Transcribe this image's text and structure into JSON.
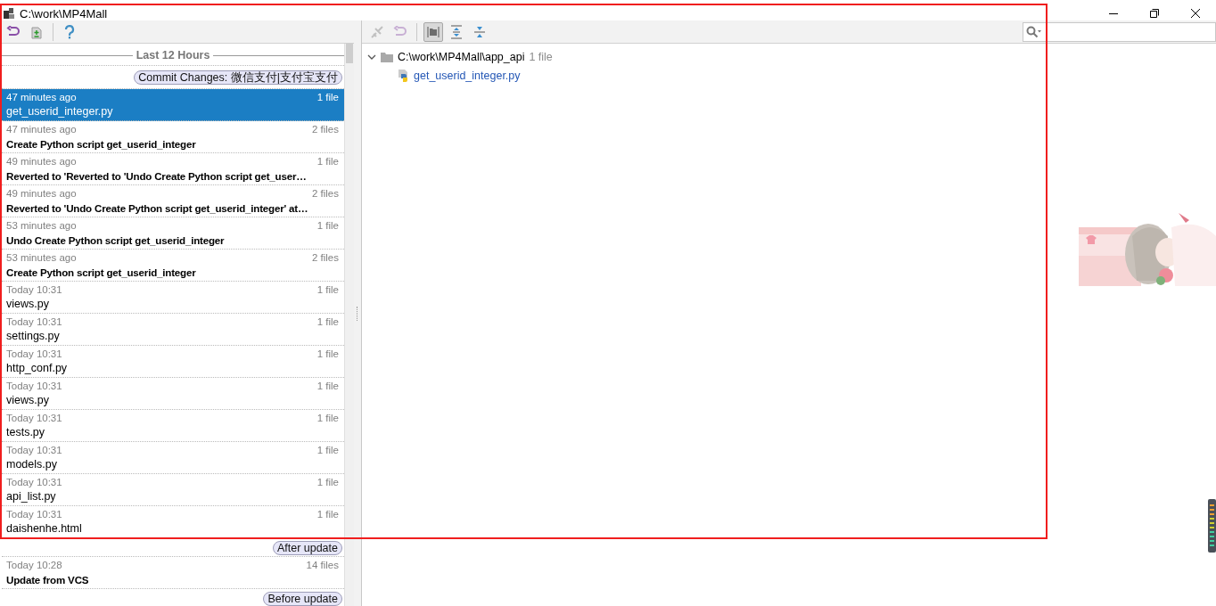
{
  "window": {
    "title": "C:\\work\\MP4Mall"
  },
  "left_toolbar": [
    {
      "kind": "undo",
      "disabled": false
    },
    {
      "kind": "patch",
      "disabled": false
    },
    {
      "kind": "separator"
    },
    {
      "kind": "help",
      "disabled": false
    }
  ],
  "right_toolbar": [
    {
      "kind": "revert",
      "disabled": true,
      "pressed": false
    },
    {
      "kind": "undo",
      "disabled": true,
      "pressed": false
    },
    {
      "kind": "separator"
    },
    {
      "kind": "group",
      "disabled": false,
      "pressed": true
    },
    {
      "kind": "expand",
      "disabled": false,
      "pressed": false
    },
    {
      "kind": "collapse",
      "disabled": false,
      "pressed": false
    }
  ],
  "history": {
    "period": "Last 12 Hours",
    "rows": [
      {
        "kind": "label",
        "text": "Commit Changes: 微信支付|支付宝支付"
      },
      {
        "kind": "entry",
        "time": "47 minutes ago",
        "count": "1 file",
        "title": "get_userid_integer.py",
        "bold": false,
        "selected": true
      },
      {
        "kind": "entry",
        "time": "47 minutes ago",
        "count": "2 files",
        "title": "Create Python script get_userid_integer",
        "bold": true,
        "selected": false
      },
      {
        "kind": "entry",
        "time": "49 minutes ago",
        "count": "1 file",
        "title": "Reverted to 'Reverted to 'Undo Create Python script get_user…",
        "bold": true,
        "selected": false
      },
      {
        "kind": "entry",
        "time": "49 minutes ago",
        "count": "2 files",
        "title": "Reverted to 'Undo Create Python script get_userid_integer' at…",
        "bold": true,
        "selected": false
      },
      {
        "kind": "entry",
        "time": "53 minutes ago",
        "count": "1 file",
        "title": "Undo Create Python script get_userid_integer",
        "bold": true,
        "selected": false
      },
      {
        "kind": "entry",
        "time": "53 minutes ago",
        "count": "2 files",
        "title": "Create Python script get_userid_integer",
        "bold": true,
        "selected": false
      },
      {
        "kind": "entry",
        "time": "Today 10:31",
        "count": "1 file",
        "title": "views.py",
        "bold": false,
        "selected": false
      },
      {
        "kind": "entry",
        "time": "Today 10:31",
        "count": "1 file",
        "title": "settings.py",
        "bold": false,
        "selected": false
      },
      {
        "kind": "entry",
        "time": "Today 10:31",
        "count": "1 file",
        "title": "http_conf.py",
        "bold": false,
        "selected": false
      },
      {
        "kind": "entry",
        "time": "Today 10:31",
        "count": "1 file",
        "title": "views.py",
        "bold": false,
        "selected": false
      },
      {
        "kind": "entry",
        "time": "Today 10:31",
        "count": "1 file",
        "title": "tests.py",
        "bold": false,
        "selected": false
      },
      {
        "kind": "entry",
        "time": "Today 10:31",
        "count": "1 file",
        "title": "models.py",
        "bold": false,
        "selected": false
      },
      {
        "kind": "entry",
        "time": "Today 10:31",
        "count": "1 file",
        "title": "api_list.py",
        "bold": false,
        "selected": false
      },
      {
        "kind": "entry",
        "time": "Today 10:31",
        "count": "1 file",
        "title": "daishenhe.html",
        "bold": false,
        "selected": false
      },
      {
        "kind": "label",
        "text": "After update"
      },
      {
        "kind": "entry",
        "time": "Today 10:28",
        "count": "14 files",
        "title": "Update from VCS",
        "bold": true,
        "selected": false
      },
      {
        "kind": "label",
        "text": "Before update"
      }
    ]
  },
  "changes": {
    "folder": {
      "path": "C:\\work\\MP4Mall\\app_api",
      "count": "1 file",
      "expanded": true,
      "files": [
        {
          "name": "get_userid_integer.py"
        }
      ]
    }
  }
}
